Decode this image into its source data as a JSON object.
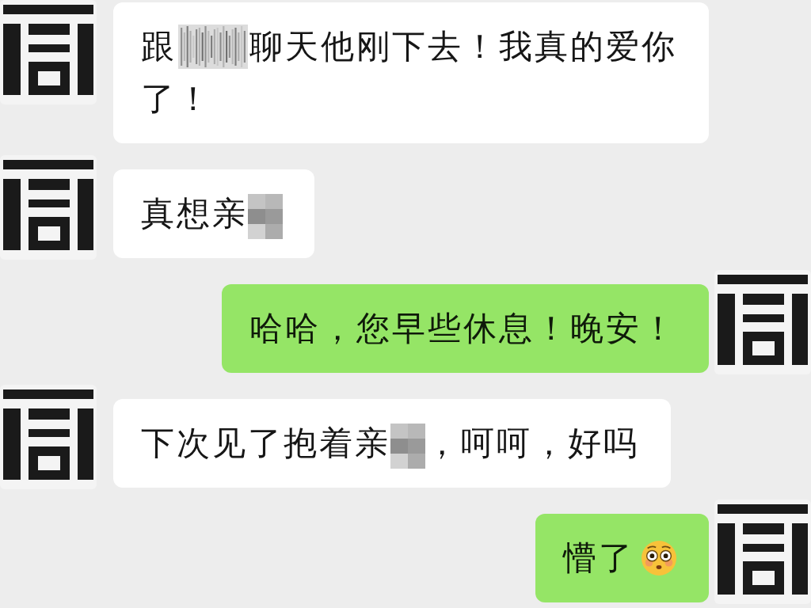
{
  "messages": [
    {
      "kind": "incoming",
      "lines": [
        {
          "parts": [
            {
              "kind": "text",
              "text": "跟"
            },
            {
              "kind": "blur"
            },
            {
              "kind": "text",
              "text": "聊天他刚下去！我真的爱你"
            }
          ]
        },
        {
          "parts": [
            {
              "kind": "text",
              "text": "了！"
            }
          ]
        }
      ]
    },
    {
      "kind": "incoming",
      "lines": [
        {
          "parts": [
            {
              "kind": "text",
              "text": "真想亲"
            },
            {
              "kind": "mosaic"
            }
          ]
        }
      ]
    },
    {
      "kind": "outgoing",
      "lines": [
        {
          "parts": [
            {
              "kind": "text",
              "text": "哈哈，您早些休息！晚安！"
            }
          ]
        }
      ]
    },
    {
      "kind": "incoming",
      "lines": [
        {
          "parts": [
            {
              "kind": "text",
              "text": "下次见了抱着亲"
            },
            {
              "kind": "mosaic"
            },
            {
              "kind": "text",
              "text": "，呵呵，好吗"
            }
          ]
        }
      ]
    },
    {
      "kind": "outgoing",
      "lines": [
        {
          "parts": [
            {
              "kind": "text",
              "text": "懵了"
            },
            {
              "kind": "emoji"
            }
          ]
        }
      ]
    }
  ]
}
